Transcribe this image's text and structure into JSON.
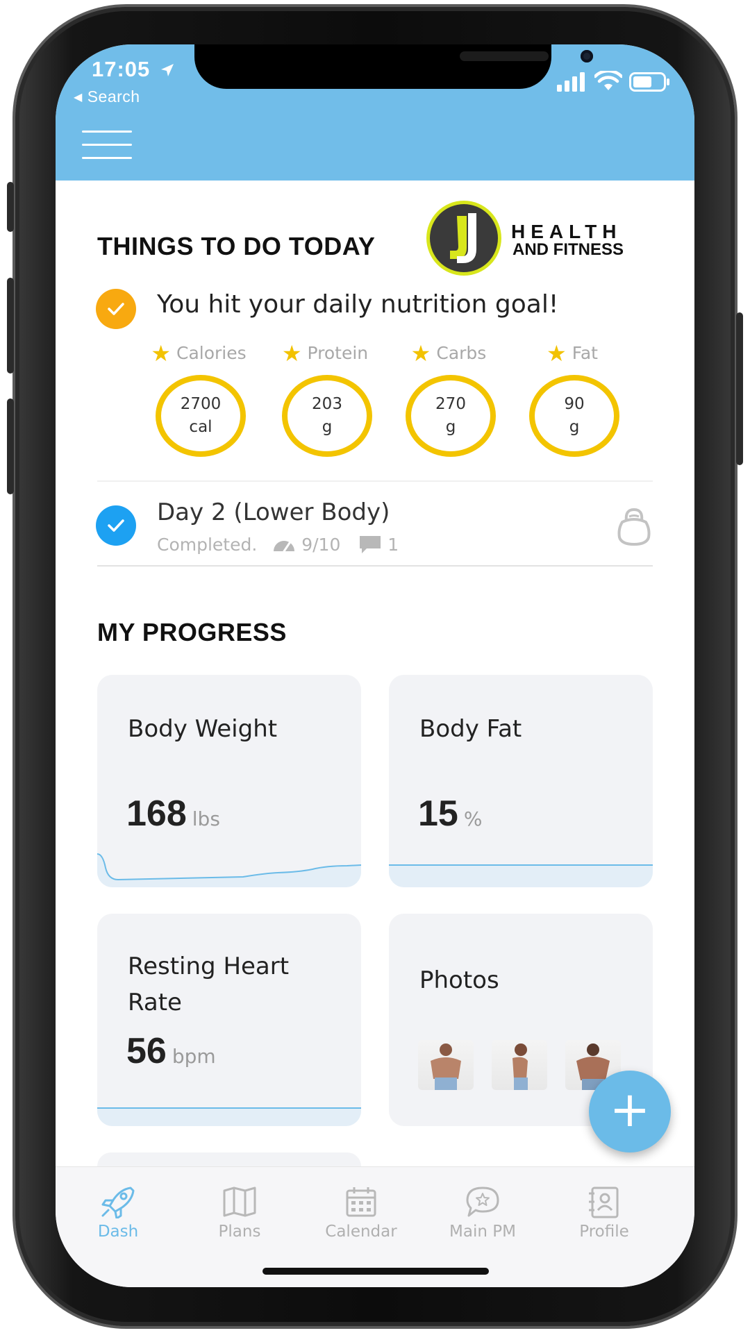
{
  "status_bar": {
    "time": "17:05",
    "back_label": "Search"
  },
  "today": {
    "title": "THINGS TO DO TODAY",
    "logo": {
      "line1": "HEALTH",
      "line2": "AND FITNESS"
    },
    "nutrition_message": "You hit your daily nutrition goal!",
    "macros": [
      {
        "label": "Calories",
        "value": "2700",
        "unit": "cal"
      },
      {
        "label": "Protein",
        "value": "203",
        "unit": "g"
      },
      {
        "label": "Carbs",
        "value": "270",
        "unit": "g"
      },
      {
        "label": "Fat",
        "value": "90",
        "unit": "g"
      }
    ],
    "workout": {
      "title": "Day 2 (Lower Body)",
      "status": "Completed.",
      "rating": "9/10",
      "comments": "1"
    }
  },
  "progress": {
    "title": "MY PROGRESS",
    "body_weight": {
      "title": "Body Weight",
      "value": "168",
      "unit": "lbs"
    },
    "body_fat": {
      "title": "Body Fat",
      "value": "15",
      "unit": "%"
    },
    "resting_hr": {
      "title": "Resting Heart Rate",
      "value": "56",
      "unit": "bpm"
    },
    "photos": {
      "title": "Photos"
    }
  },
  "fab": {
    "label": "+"
  },
  "tabs": [
    {
      "label": "Dash",
      "icon": "rocket-icon",
      "active": true
    },
    {
      "label": "Plans",
      "icon": "map-icon",
      "active": false
    },
    {
      "label": "Calendar",
      "icon": "calendar-icon",
      "active": false
    },
    {
      "label": "Main PM",
      "icon": "chat-star-icon",
      "active": false
    },
    {
      "label": "Profile",
      "icon": "profile-icon",
      "active": false
    }
  ],
  "colors": {
    "header": "#71bde9",
    "accent": "#6bbbe8",
    "gold": "#f3c400",
    "nutrition_check": "#f8a910",
    "workout_check": "#1da1f2"
  }
}
